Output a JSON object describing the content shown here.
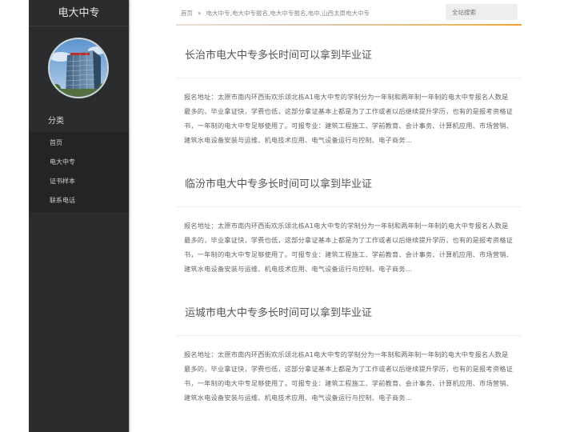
{
  "sidebar": {
    "site_title": "电大中专",
    "category_heading": "分类",
    "items": [
      {
        "label": "首页"
      },
      {
        "label": "电大中专"
      },
      {
        "label": "证书样本"
      },
      {
        "label": "联系电话"
      }
    ]
  },
  "header": {
    "breadcrumb_home": "首页",
    "breadcrumb_sep": "»",
    "breadcrumb_tags": "电大中专,电大中专报名,电大中专报名,电中,山西太原电大中专",
    "search_placeholder": "全站搜索"
  },
  "articles": [
    {
      "title": "长治市电大中专多长时间可以拿到毕业证",
      "excerpt": "报名地址：太原市南内环西街欢乐颂北栋A1电大中专的学制分为一年制和两年制一年制的电大中专报名人数是最多的，毕业拿证快，学费也低，这部分拿证基本上都是为了工作或者以后继续提升学历，也有的是报考资格证书，一年制的电大中专足够使用了。可报专业：建筑工程施工、学前教育、会计事务、计算机应用、市场营销、建筑水电设备安装与运维、机电技术应用、电气设备运行与控制、电子商务..."
    },
    {
      "title": "临汾市电大中专多长时间可以拿到毕业证",
      "excerpt": "报名地址：太原市南内环西街欢乐颂北栋A1电大中专的学制分为一年制和两年制一年制的电大中专报名人数是最多的，毕业拿证快，学费也低，这部分拿证基本上都是为了工作或者以后继续提升学历，也有的是报考资格证书，一年制的电大中专足够使用了。可报专业：建筑工程施工、学前教育、会计事务、计算机应用、市场营销、建筑水电设备安装与运维、机电技术应用、电气设备运行与控制、电子商务..."
    },
    {
      "title": "运城市电大中专多长时间可以拿到毕业证",
      "excerpt": "报名地址：太原市南内环西街欢乐颂北栋A1电大中专的学制分为一年制和两年制一年制的电大中专报名人数是最多的，毕业拿证快，学费也低，这部分拿证基本上都是为了工作或者以后继续提升学历，也有的是报考资格证书，一年制的电大中专足够使用了。可报专业：建筑工程施工、学前教育、会计事务、计算机应用、市场营销、建筑水电设备安装与运维、机电技术应用、电气设备运行与控制、电子商务..."
    }
  ],
  "colors": {
    "sidebar_bg": "#2b2c2e",
    "nav_list_bg": "#232426",
    "accent_line": "#f0a030"
  }
}
